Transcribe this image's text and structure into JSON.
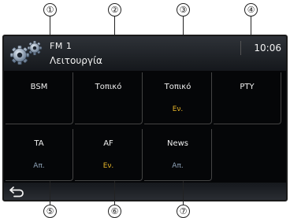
{
  "callouts": [
    "①",
    "②",
    "③",
    "④",
    "⑤",
    "⑥",
    "⑦"
  ],
  "header": {
    "source": "FM  1",
    "title": "Λειτουργία",
    "clock": "10:06",
    "settings_icon": "gear-icon"
  },
  "tiles": [
    {
      "label": "BSM",
      "status": ""
    },
    {
      "label": "Τοπικό",
      "status": ""
    },
    {
      "label": "Τοπικό",
      "status": "Εν."
    },
    {
      "label": "PTY",
      "status": ""
    },
    {
      "label": "TA",
      "status": "Απ."
    },
    {
      "label": "AF",
      "status": "Εν."
    },
    {
      "label": "News",
      "status": "Απ."
    }
  ],
  "footer": {
    "back_icon": "back-arrow-icon"
  },
  "colors": {
    "status_on": "#e6b428",
    "status_off": "#8fa3b8",
    "background": "#050608"
  }
}
